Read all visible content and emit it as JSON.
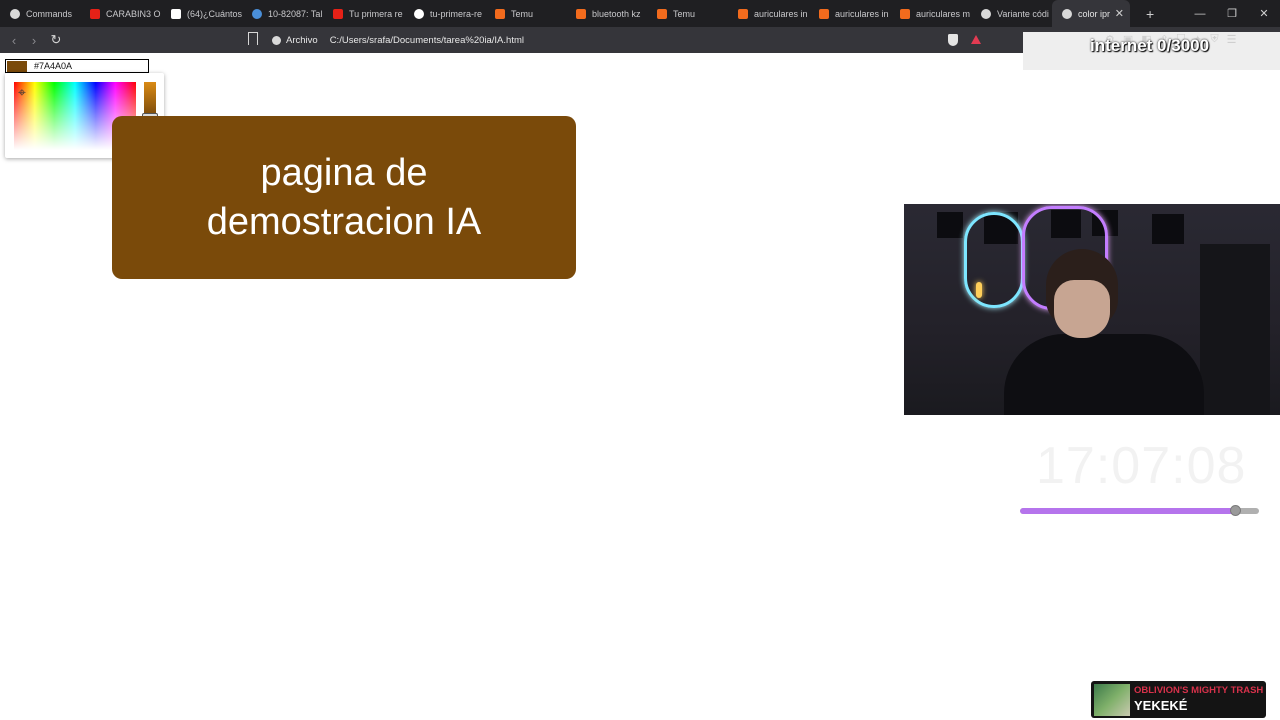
{
  "browser": {
    "tabs": [
      {
        "label": "Commands",
        "icon": "app-icon",
        "color": "#d9d9d9"
      },
      {
        "label": "CARABIN3 O",
        "icon": "youtube-icon",
        "color": "#e62117"
      },
      {
        "label": "(64)¿Cuántos",
        "icon": "tiktok-icon",
        "color": "#ffffff"
      },
      {
        "label": "10-82087: Tal",
        "icon": "app-icon",
        "color": "#4a8fd9"
      },
      {
        "label": "Tu primera re",
        "icon": "youtube-icon",
        "color": "#e62117"
      },
      {
        "label": "tu-primera-re",
        "icon": "github-icon",
        "color": "#ffffff"
      },
      {
        "label": "Temu",
        "icon": "temu-icon",
        "color": "#f26b1d"
      },
      {
        "label": "bluetooth kz",
        "icon": "temu-icon",
        "color": "#f26b1d"
      },
      {
        "label": "Temu",
        "icon": "temu-icon",
        "color": "#f26b1d"
      },
      {
        "label": "auriculares in",
        "icon": "temu-icon",
        "color": "#f26b1d"
      },
      {
        "label": "auriculares in",
        "icon": "temu-icon",
        "color": "#f26b1d"
      },
      {
        "label": "auriculares m",
        "icon": "temu-icon",
        "color": "#f26b1d"
      },
      {
        "label": "Variante códi",
        "icon": "chatgpt-icon",
        "color": "#d9d9d9"
      },
      {
        "label": "color ipr",
        "icon": "globe-icon",
        "color": "#d9d9d9",
        "active": true
      }
    ],
    "address": {
      "scheme_label": "Archivo",
      "path": "C:/Users/srafa/Documents/tarea%20ia/IA.html"
    },
    "counter_overlay": "internet 0/3000"
  },
  "page": {
    "color_input": {
      "value": "#7A4A0A",
      "color": "#7A4A0A"
    },
    "demo_box": {
      "title_line1": "pagina de",
      "title_line2": "demostracion IA",
      "background": "#7A4A0A"
    }
  },
  "stream_overlay": {
    "clock": "17:07:08",
    "progress_fraction": 0.9,
    "now_playing": {
      "title": "OBLIVION'S MIGHTY TRASH",
      "artist": "YEKEKÉ"
    }
  }
}
